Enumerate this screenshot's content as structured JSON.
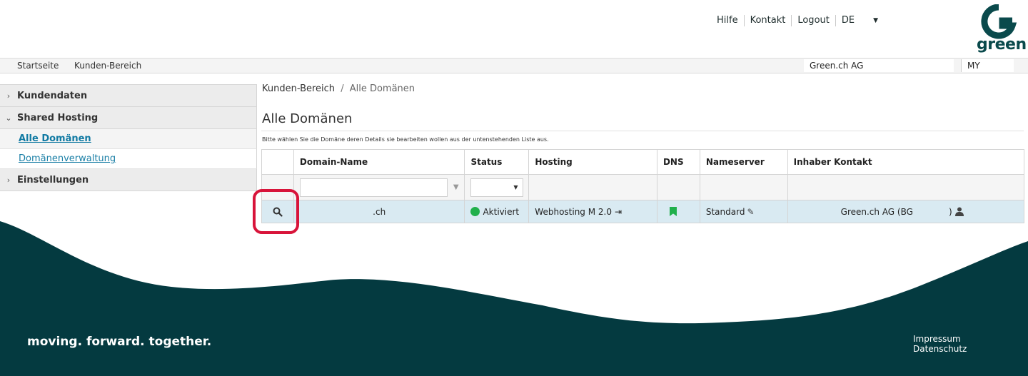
{
  "header": {
    "links": [
      "Hilfe",
      "Kontakt",
      "Logout",
      "DE"
    ],
    "logo_text": "green"
  },
  "nav": {
    "items": [
      "Startseite",
      "Kunden-Bereich"
    ],
    "company": "Green.ch AG",
    "account": "MY"
  },
  "sidebar": {
    "sections": [
      {
        "label": "Kundendaten",
        "expanded": false
      },
      {
        "label": "Shared Hosting",
        "expanded": true,
        "items": [
          "Alle Domänen",
          "Domänenverwaltung"
        ]
      },
      {
        "label": "Einstellungen",
        "expanded": false
      }
    ]
  },
  "breadcrumb": {
    "parent": "Kunden-Bereich",
    "separator": "/",
    "current": "Alle Domänen"
  },
  "page": {
    "title": "Alle Domänen",
    "hint": "Bitte wählen Sie die Domäne deren Details sie bearbeiten wollen aus der untenstehenden Liste aus."
  },
  "grid": {
    "columns": [
      "",
      "Domain-Name",
      "Status",
      "Hosting",
      "DNS",
      "Nameserver",
      "Inhaber Kontakt"
    ],
    "rows": [
      {
        "domain": ".ch",
        "status": "Aktiviert",
        "hosting": "Webhosting M 2.0",
        "nameserver": "Standard",
        "owner": "Green.ch AG (BG",
        "owner_tail": ")"
      }
    ]
  },
  "footer": {
    "tagline": "moving. forward. together.",
    "links": [
      "Impressum",
      "Datenschutz"
    ]
  },
  "colors": {
    "brand": "#0a4a4c",
    "footer_bg": "#043a40",
    "row_selected": "#d9eaf2",
    "status_ok": "#21b04c",
    "highlight": "#d8143a"
  }
}
